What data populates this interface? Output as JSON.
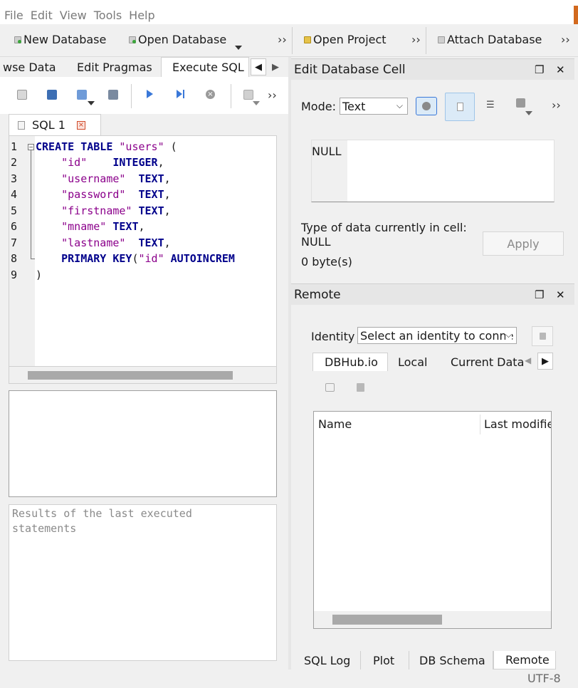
{
  "menu": [
    "File",
    "Edit",
    "View",
    "Tools",
    "Help"
  ],
  "toolbar": {
    "new_database": "New Database",
    "open_database": "Open Database",
    "open_project": "Open Project",
    "attach_database": "Attach Database",
    "overflow": "››"
  },
  "main_tabs": [
    "wse Data",
    "Edit Pragmas",
    "Execute SQL"
  ],
  "sql_tab": {
    "label": "SQL 1",
    "close": "×"
  },
  "editor": {
    "line_numbers": [
      "1",
      "2",
      "3",
      "4",
      "5",
      "6",
      "7",
      "8",
      "9"
    ]
  },
  "messages": {
    "line1": "Results of the last executed",
    "line2": "statements"
  },
  "edit_cell": {
    "title": "Edit Database Cell",
    "mode_label": "Mode:",
    "mode_value": "Text",
    "null_label": "NULL",
    "type_label": "Type of data currently in cell:",
    "type_value": "NULL",
    "size": "0 byte(s)",
    "apply": "Apply"
  },
  "remote": {
    "title": "Remote",
    "identity_label": "Identity",
    "identity_value": "Select an identity to conne",
    "tabs": [
      "DBHub.io",
      "Local",
      "Current Datal"
    ],
    "columns": [
      "Name",
      "Last modified"
    ]
  },
  "bottom_tabs": [
    "SQL Log",
    "Plot",
    "DB Schema",
    "Remote"
  ],
  "status": {
    "encoding": "UTF-8"
  },
  "colors": {
    "keyword": "#00008b",
    "string": "#8b008b",
    "accent": "#dbeaf7"
  },
  "icons": {
    "panel_float": "float-icon",
    "panel_close": "close-icon"
  }
}
